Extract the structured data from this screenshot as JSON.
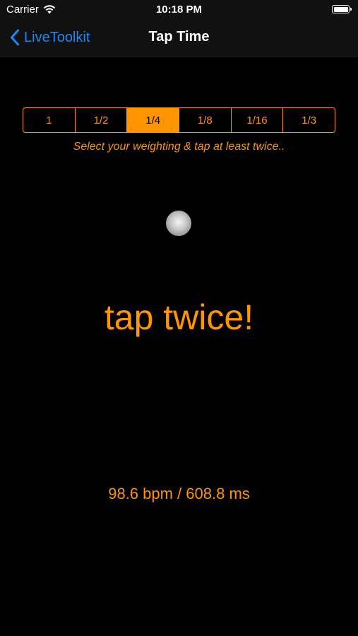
{
  "status_bar": {
    "carrier": "Carrier",
    "time": "10:18 PM"
  },
  "nav": {
    "back_label": "LiveToolkit",
    "title": "Tap Time"
  },
  "weighting": {
    "options": [
      "1",
      "1/2",
      "1/4",
      "1/8",
      "1/16",
      "1/3"
    ],
    "selected": "1/4"
  },
  "instruction": "Select your weighting & tap at least twice..",
  "tap_prompt": "tap twice!",
  "tempo": "98.6 bpm / 608.8 ms",
  "colors": {
    "accent": "#ff9500",
    "link": "#1e88f0",
    "background": "#000000"
  }
}
